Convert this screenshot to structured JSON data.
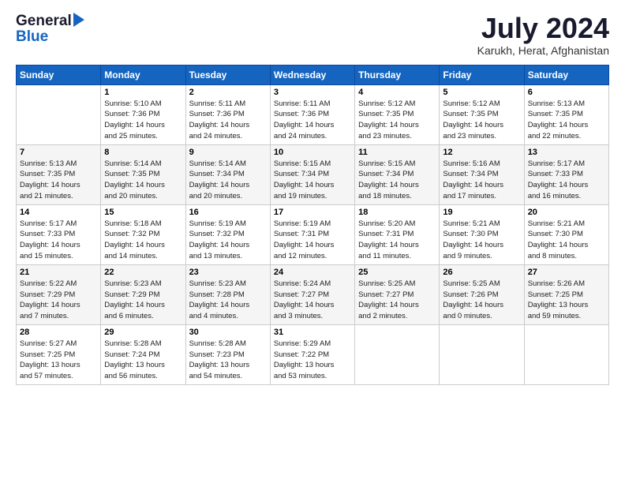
{
  "header": {
    "logo_line1": "General",
    "logo_line2": "Blue",
    "title": "July 2024",
    "subtitle": "Karukh, Herat, Afghanistan"
  },
  "days_of_week": [
    "Sunday",
    "Monday",
    "Tuesday",
    "Wednesday",
    "Thursday",
    "Friday",
    "Saturday"
  ],
  "weeks": [
    [
      {
        "num": "",
        "info": ""
      },
      {
        "num": "1",
        "info": "Sunrise: 5:10 AM\nSunset: 7:36 PM\nDaylight: 14 hours\nand 25 minutes."
      },
      {
        "num": "2",
        "info": "Sunrise: 5:11 AM\nSunset: 7:36 PM\nDaylight: 14 hours\nand 24 minutes."
      },
      {
        "num": "3",
        "info": "Sunrise: 5:11 AM\nSunset: 7:36 PM\nDaylight: 14 hours\nand 24 minutes."
      },
      {
        "num": "4",
        "info": "Sunrise: 5:12 AM\nSunset: 7:35 PM\nDaylight: 14 hours\nand 23 minutes."
      },
      {
        "num": "5",
        "info": "Sunrise: 5:12 AM\nSunset: 7:35 PM\nDaylight: 14 hours\nand 23 minutes."
      },
      {
        "num": "6",
        "info": "Sunrise: 5:13 AM\nSunset: 7:35 PM\nDaylight: 14 hours\nand 22 minutes."
      }
    ],
    [
      {
        "num": "7",
        "info": "Sunrise: 5:13 AM\nSunset: 7:35 PM\nDaylight: 14 hours\nand 21 minutes."
      },
      {
        "num": "8",
        "info": "Sunrise: 5:14 AM\nSunset: 7:35 PM\nDaylight: 14 hours\nand 20 minutes."
      },
      {
        "num": "9",
        "info": "Sunrise: 5:14 AM\nSunset: 7:34 PM\nDaylight: 14 hours\nand 20 minutes."
      },
      {
        "num": "10",
        "info": "Sunrise: 5:15 AM\nSunset: 7:34 PM\nDaylight: 14 hours\nand 19 minutes."
      },
      {
        "num": "11",
        "info": "Sunrise: 5:15 AM\nSunset: 7:34 PM\nDaylight: 14 hours\nand 18 minutes."
      },
      {
        "num": "12",
        "info": "Sunrise: 5:16 AM\nSunset: 7:34 PM\nDaylight: 14 hours\nand 17 minutes."
      },
      {
        "num": "13",
        "info": "Sunrise: 5:17 AM\nSunset: 7:33 PM\nDaylight: 14 hours\nand 16 minutes."
      }
    ],
    [
      {
        "num": "14",
        "info": "Sunrise: 5:17 AM\nSunset: 7:33 PM\nDaylight: 14 hours\nand 15 minutes."
      },
      {
        "num": "15",
        "info": "Sunrise: 5:18 AM\nSunset: 7:32 PM\nDaylight: 14 hours\nand 14 minutes."
      },
      {
        "num": "16",
        "info": "Sunrise: 5:19 AM\nSunset: 7:32 PM\nDaylight: 14 hours\nand 13 minutes."
      },
      {
        "num": "17",
        "info": "Sunrise: 5:19 AM\nSunset: 7:31 PM\nDaylight: 14 hours\nand 12 minutes."
      },
      {
        "num": "18",
        "info": "Sunrise: 5:20 AM\nSunset: 7:31 PM\nDaylight: 14 hours\nand 11 minutes."
      },
      {
        "num": "19",
        "info": "Sunrise: 5:21 AM\nSunset: 7:30 PM\nDaylight: 14 hours\nand 9 minutes."
      },
      {
        "num": "20",
        "info": "Sunrise: 5:21 AM\nSunset: 7:30 PM\nDaylight: 14 hours\nand 8 minutes."
      }
    ],
    [
      {
        "num": "21",
        "info": "Sunrise: 5:22 AM\nSunset: 7:29 PM\nDaylight: 14 hours\nand 7 minutes."
      },
      {
        "num": "22",
        "info": "Sunrise: 5:23 AM\nSunset: 7:29 PM\nDaylight: 14 hours\nand 6 minutes."
      },
      {
        "num": "23",
        "info": "Sunrise: 5:23 AM\nSunset: 7:28 PM\nDaylight: 14 hours\nand 4 minutes."
      },
      {
        "num": "24",
        "info": "Sunrise: 5:24 AM\nSunset: 7:27 PM\nDaylight: 14 hours\nand 3 minutes."
      },
      {
        "num": "25",
        "info": "Sunrise: 5:25 AM\nSunset: 7:27 PM\nDaylight: 14 hours\nand 2 minutes."
      },
      {
        "num": "26",
        "info": "Sunrise: 5:25 AM\nSunset: 7:26 PM\nDaylight: 14 hours\nand 0 minutes."
      },
      {
        "num": "27",
        "info": "Sunrise: 5:26 AM\nSunset: 7:25 PM\nDaylight: 13 hours\nand 59 minutes."
      }
    ],
    [
      {
        "num": "28",
        "info": "Sunrise: 5:27 AM\nSunset: 7:25 PM\nDaylight: 13 hours\nand 57 minutes."
      },
      {
        "num": "29",
        "info": "Sunrise: 5:28 AM\nSunset: 7:24 PM\nDaylight: 13 hours\nand 56 minutes."
      },
      {
        "num": "30",
        "info": "Sunrise: 5:28 AM\nSunset: 7:23 PM\nDaylight: 13 hours\nand 54 minutes."
      },
      {
        "num": "31",
        "info": "Sunrise: 5:29 AM\nSunset: 7:22 PM\nDaylight: 13 hours\nand 53 minutes."
      },
      {
        "num": "",
        "info": ""
      },
      {
        "num": "",
        "info": ""
      },
      {
        "num": "",
        "info": ""
      }
    ]
  ]
}
